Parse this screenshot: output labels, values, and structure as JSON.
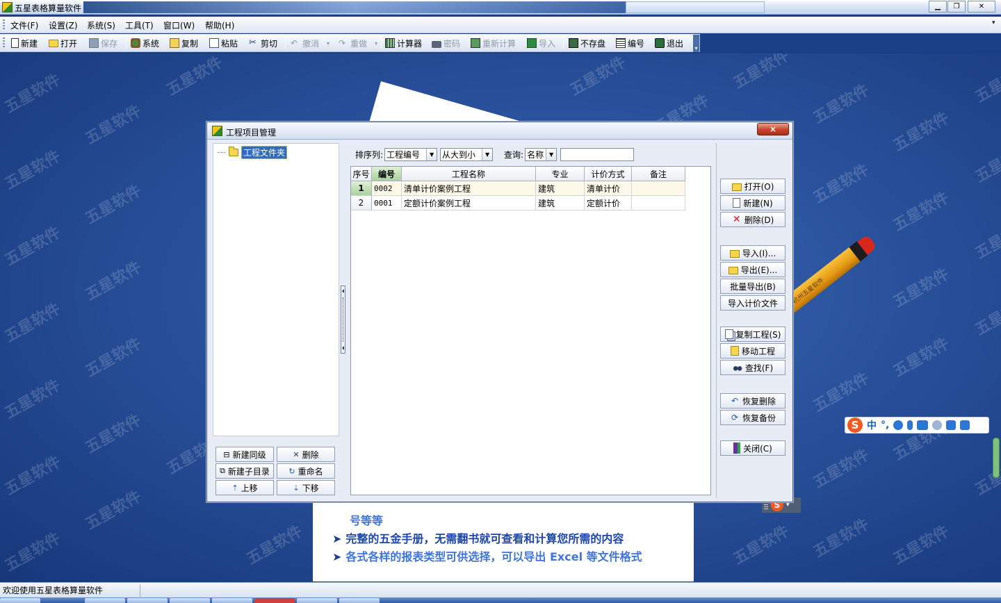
{
  "window": {
    "title": "五星表格算量软件"
  },
  "menu": [
    "文件(F)",
    "设置(Z)",
    "系统(S)",
    "工具(T)",
    "窗口(W)",
    "帮助(H)"
  ],
  "toolbar": {
    "new": "新建",
    "open": "打开",
    "save": "保存",
    "system": "系统",
    "copy": "复制",
    "paste": "粘贴",
    "cut": "剪切",
    "undo": "撤消",
    "redo": "重做",
    "calculator": "计算器",
    "password": "密码",
    "recalc": "重新计算",
    "import": "导入",
    "nosave": "不存盘",
    "number": "编号",
    "exit": "退出"
  },
  "watermark": "五星软件",
  "pencil_text": "杭州五星软件",
  "background_text": {
    "line1": "号等等",
    "line2": "完整的五金手册，无需翻书就可查看和计算您所需的内容",
    "line3": "各式各样的报表类型可供选择，可以导出 Excel 等文件格式"
  },
  "ime": {
    "logo": "S",
    "lang": "中",
    "punct": "°,"
  },
  "dialog": {
    "title": "工程项目管理",
    "close": "×",
    "tree": {
      "root": "工程文件夹"
    },
    "tree_buttons": {
      "new_sibling": "新建同级",
      "delete": "删除",
      "new_child": "新建子目录",
      "rename": "重命名",
      "move_up": "上移",
      "move_down": "下移"
    },
    "filter": {
      "sort_label": "排序列:",
      "sort_value": "工程编号",
      "order_value": "从大到小",
      "query_label": "查询:",
      "query_field": "名称",
      "query_text": ""
    },
    "table": {
      "columns": [
        "序号",
        "编号",
        "工程名称",
        "专业",
        "计价方式",
        "备注"
      ],
      "rows": [
        {
          "seq": "1",
          "code": "0002",
          "name": "清单计价案例工程",
          "discipline": "建筑",
          "pricing": "清单计价",
          "note": ""
        },
        {
          "seq": "2",
          "code": "0001",
          "name": "定额计价案例工程",
          "discipline": "建筑",
          "pricing": "定额计价",
          "note": ""
        }
      ]
    },
    "actions": {
      "open": "打开(O)",
      "new": "新建(N)",
      "delete": "删除(D)",
      "import": "导入(I)...",
      "export": "导出(E)...",
      "batch_export": "批量导出(B)",
      "import_pricing": "导入计价文件",
      "copy_project": "复制工程(S)",
      "move_project": "移动工程",
      "find": "查找(F)",
      "restore_deleted": "恢复删除",
      "restore_backup": "恢复备份",
      "close": "关闭(C)"
    }
  },
  "status": {
    "message": "欢迎使用五星表格算量软件"
  }
}
